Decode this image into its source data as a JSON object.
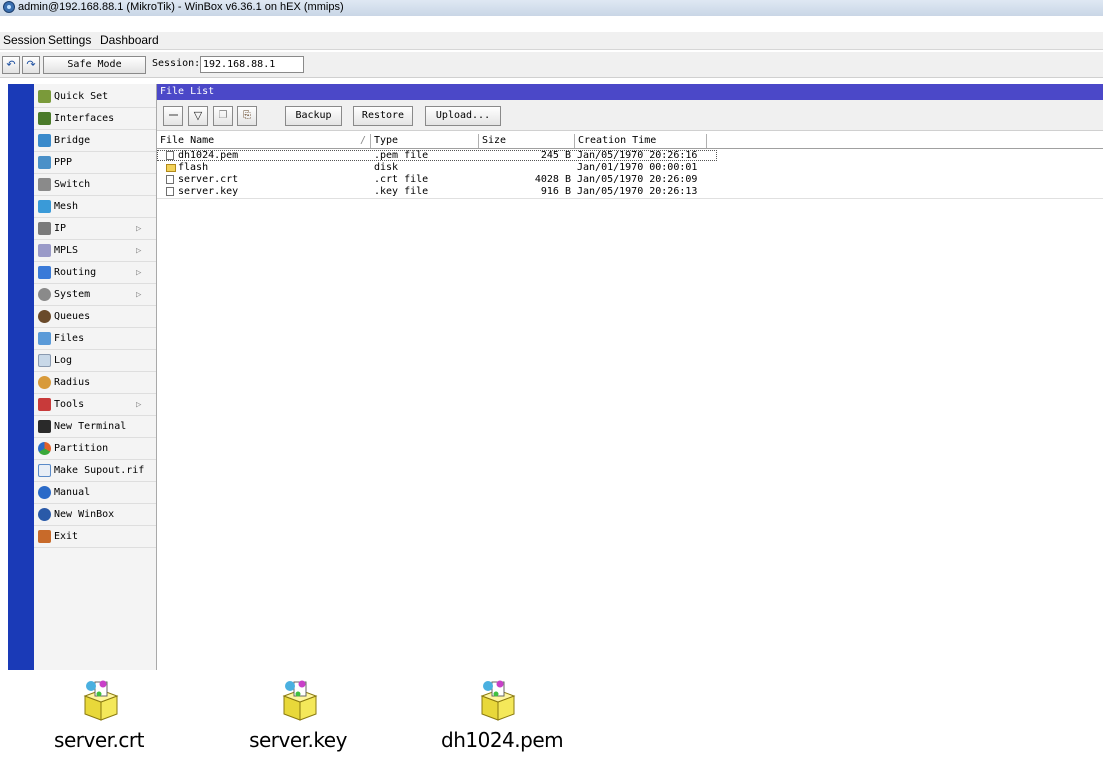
{
  "window": {
    "title": "admin@192.168.88.1 (MikroTik) - WinBox v6.36.1 on hEX (mmips)"
  },
  "menu": [
    "Session",
    "Settings",
    "Dashboard"
  ],
  "toolbar": {
    "undo_icon": "undo-icon",
    "redo_icon": "redo-icon",
    "safe_mode": "Safe Mode",
    "session_label": "Session:",
    "session_value": "192.168.88.1"
  },
  "sidebar": {
    "items": [
      {
        "label": "Quick Set",
        "icon": "quick-set-icon",
        "color": "#7a9a3a",
        "submenu": false
      },
      {
        "label": "Interfaces",
        "icon": "interfaces-icon",
        "color": "#4a7a2a",
        "submenu": false
      },
      {
        "label": "Bridge",
        "icon": "bridge-icon",
        "color": "#3a8acb",
        "submenu": false
      },
      {
        "label": "PPP",
        "icon": "ppp-icon",
        "color": "#4a90c8",
        "submenu": false
      },
      {
        "label": "Switch",
        "icon": "switch-icon",
        "color": "#8a8a8a",
        "submenu": false
      },
      {
        "label": "Mesh",
        "icon": "mesh-icon",
        "color": "#3a9ad8",
        "submenu": false
      },
      {
        "label": "IP",
        "icon": "ip-icon",
        "color": "#7a7a7a",
        "submenu": true
      },
      {
        "label": "MPLS",
        "icon": "mpls-icon",
        "color": "#9a9ac8",
        "submenu": true
      },
      {
        "label": "Routing",
        "icon": "routing-icon",
        "color": "#3a7ad8",
        "submenu": true
      },
      {
        "label": "System",
        "icon": "system-icon",
        "color": "#8a8a8a",
        "submenu": true
      },
      {
        "label": "Queues",
        "icon": "queues-icon",
        "color": "#6a4a2a",
        "submenu": false
      },
      {
        "label": "Files",
        "icon": "files-icon",
        "color": "#5a9ad8",
        "submenu": false
      },
      {
        "label": "Log",
        "icon": "log-icon",
        "color": "#c8d8e8",
        "submenu": false
      },
      {
        "label": "Radius",
        "icon": "radius-icon",
        "color": "#d89a3a",
        "submenu": false
      },
      {
        "label": "Tools",
        "icon": "tools-icon",
        "color": "#c83a3a",
        "submenu": true
      },
      {
        "label": "New Terminal",
        "icon": "terminal-icon",
        "color": "#2a2a2a",
        "submenu": false
      },
      {
        "label": "Partition",
        "icon": "partition-icon",
        "color": "#e0602a",
        "submenu": false
      },
      {
        "label": "Make Supout.rif",
        "icon": "supout-icon",
        "color": "#5a8ac8",
        "submenu": false
      },
      {
        "label": "Manual",
        "icon": "manual-icon",
        "color": "#2a6ac8",
        "submenu": false
      },
      {
        "label": "New WinBox",
        "icon": "winbox-icon",
        "color": "#2a5aa8",
        "submenu": false
      },
      {
        "label": "Exit",
        "icon": "exit-icon",
        "color": "#c86a2a",
        "submenu": false
      }
    ]
  },
  "file_list": {
    "title": "File List",
    "tools": {
      "remove_icon": "remove-icon",
      "filter_icon": "filter-icon",
      "copy_icon": "copy-icon",
      "paste_icon": "paste-icon",
      "backup": "Backup",
      "restore": "Restore",
      "upload": "Upload..."
    },
    "columns": [
      "File Name",
      "Type",
      "Size",
      "Creation Time"
    ],
    "rows": [
      {
        "name": "dh1024.pem",
        "type": ".pem file",
        "size": "245 B",
        "created": "Jan/05/1970 20:26:16",
        "icon": "file-icon"
      },
      {
        "name": "flash",
        "type": "disk",
        "size": "",
        "created": "Jan/01/1970 00:00:01",
        "icon": "folder-icon"
      },
      {
        "name": "server.crt",
        "type": ".crt file",
        "size": "4028 B",
        "created": "Jan/05/1970 20:26:09",
        "icon": "file-icon"
      },
      {
        "name": "server.key",
        "type": ".key file",
        "size": "916 B",
        "created": "Jan/05/1970 20:26:13",
        "icon": "file-icon"
      }
    ]
  },
  "desktop_icons": [
    {
      "label": "server.crt",
      "icon": "package-icon"
    },
    {
      "label": "server.key",
      "icon": "package-icon"
    },
    {
      "label": "dh1024.pem",
      "icon": "package-icon"
    }
  ]
}
